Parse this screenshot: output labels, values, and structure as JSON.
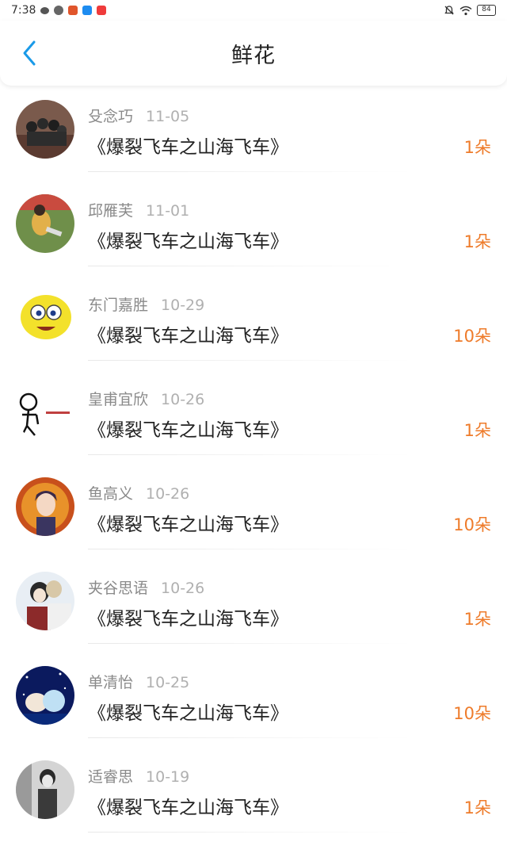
{
  "status_bar": {
    "time": "7:38",
    "battery": "84"
  },
  "header": {
    "title": "鲜花"
  },
  "items": [
    {
      "name": "殳念巧",
      "date": "11-05",
      "title": "《爆裂飞车之山海飞车》",
      "count": "1朵"
    },
    {
      "name": "邱雁芙",
      "date": "11-01",
      "title": "《爆裂飞车之山海飞车》",
      "count": "1朵"
    },
    {
      "name": "东门嘉胜",
      "date": "10-29",
      "title": "《爆裂飞车之山海飞车》",
      "count": "10朵"
    },
    {
      "name": "皇甫宜欣",
      "date": "10-26",
      "title": "《爆裂飞车之山海飞车》",
      "count": "1朵"
    },
    {
      "name": "鱼高义",
      "date": "10-26",
      "title": "《爆裂飞车之山海飞车》",
      "count": "10朵"
    },
    {
      "name": "夹谷思语",
      "date": "10-26",
      "title": "《爆裂飞车之山海飞车》",
      "count": "1朵"
    },
    {
      "name": "单清怡",
      "date": "10-25",
      "title": "《爆裂飞车之山海飞车》",
      "count": "10朵"
    },
    {
      "name": "适睿思",
      "date": "10-19",
      "title": "《爆裂飞车之山海飞车》",
      "count": "1朵"
    }
  ],
  "colors": {
    "accent_orange": "#ee7b2a",
    "back_blue": "#1a9ae8"
  },
  "icons": {
    "back": "chevron-left-icon"
  }
}
